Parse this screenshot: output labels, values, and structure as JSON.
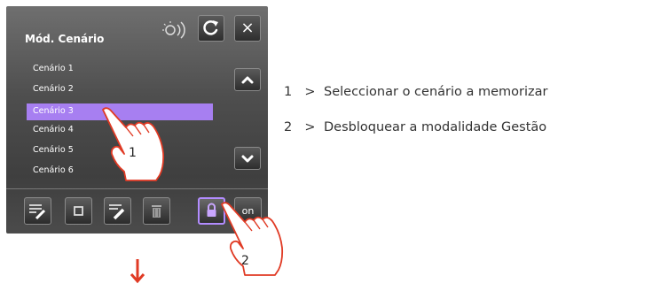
{
  "panel": {
    "title": "Mód. Cenário",
    "close_label": "×",
    "on_label": "on",
    "items": [
      {
        "label": "Cenário 1",
        "selected": false
      },
      {
        "label": "Cenário 2",
        "selected": false
      },
      {
        "label": "Cenário 3",
        "selected": true
      },
      {
        "label": "Cenário 4",
        "selected": false
      },
      {
        "label": "Cenário 5",
        "selected": false
      },
      {
        "label": "Cenário 6",
        "selected": false
      }
    ]
  },
  "callouts": {
    "hand1": "1",
    "hand2": "2"
  },
  "instructions": [
    {
      "num": "1",
      "sep": ">",
      "text": "Seleccionar o cenário a memorizar"
    },
    {
      "num": "2",
      "sep": ">",
      "text": "Desbloquear a modalidade Gestão"
    }
  ],
  "colors": {
    "selection": "#a77ff1",
    "arrow": "#e03a24",
    "accent": "#b28cff"
  }
}
